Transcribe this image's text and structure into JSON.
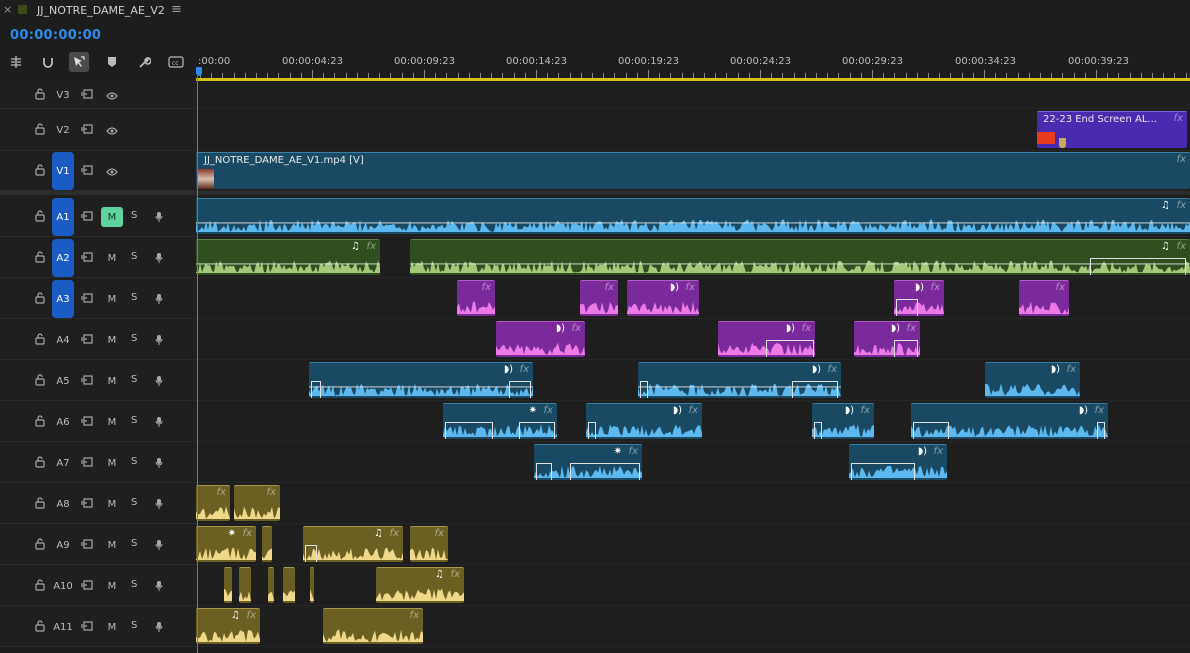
{
  "sequence_tab": {
    "title": "JJ_NOTRE_DAME_AE_V2",
    "close_glyph": "×",
    "menu_glyph": "≡"
  },
  "timecode": "00:00:00:00",
  "ruler_labels": [
    ":00:00",
    "00:00:04:23",
    "00:00:09:23",
    "00:00:14:23",
    "00:00:19:23",
    "00:00:24:23",
    "00:00:29:23",
    "00:00:34:23",
    "00:00:39:23"
  ],
  "tools": [
    "insert-tool-icon",
    "snap-icon",
    "linked-selection-icon",
    "marker-icon",
    "wrench-icon",
    "captions-icon"
  ],
  "colors": {
    "accent_blue": "#2d8ceb",
    "video_clip": "#1a4a63",
    "audio_teal": "#1a4a63",
    "audio_green": "#2f4f1e",
    "audio_purple": "#7a2a9a",
    "audio_gold": "#6b5f22",
    "graphic_purple": "#4a2bb0",
    "mute_on": "#5fd3a0"
  },
  "tracks": {
    "video": [
      {
        "name": "V3",
        "active": false
      },
      {
        "name": "V2",
        "active": false
      },
      {
        "name": "V1",
        "active": true
      }
    ],
    "audio": [
      {
        "name": "A1",
        "active": true,
        "mute": "M",
        "solo": "S",
        "mute_on": true
      },
      {
        "name": "A2",
        "active": true,
        "mute": "M",
        "solo": "S",
        "mute_on": false
      },
      {
        "name": "A3",
        "active": true,
        "mute": "M",
        "solo": "S",
        "mute_on": false
      },
      {
        "name": "A4",
        "active": false,
        "mute": "M",
        "solo": "S",
        "mute_on": false
      },
      {
        "name": "A5",
        "active": false,
        "mute": "M",
        "solo": "S",
        "mute_on": false
      },
      {
        "name": "A6",
        "active": false,
        "mute": "M",
        "solo": "S",
        "mute_on": false
      },
      {
        "name": "A7",
        "active": false,
        "mute": "M",
        "solo": "S",
        "mute_on": false
      },
      {
        "name": "A8",
        "active": false,
        "mute": "M",
        "solo": "S",
        "mute_on": false
      },
      {
        "name": "A9",
        "active": false,
        "mute": "M",
        "solo": "S",
        "mute_on": false
      },
      {
        "name": "A10",
        "active": false,
        "mute": "M",
        "solo": "S",
        "mute_on": false
      },
      {
        "name": "A11",
        "active": false,
        "mute": "M",
        "solo": "S",
        "mute_on": false
      }
    ]
  },
  "clips": {
    "v2_graphic": {
      "label": "22-23 End Screen AL...",
      "fx": "fx"
    },
    "v1_video": {
      "label": "JJ_NOTRE_DAME_AE_V1.mp4 [V]",
      "fx": "fx"
    },
    "fx_label": "fx",
    "music_glyph": "♫",
    "voice_glyph": "◗)",
    "burst_glyph": "✷"
  }
}
